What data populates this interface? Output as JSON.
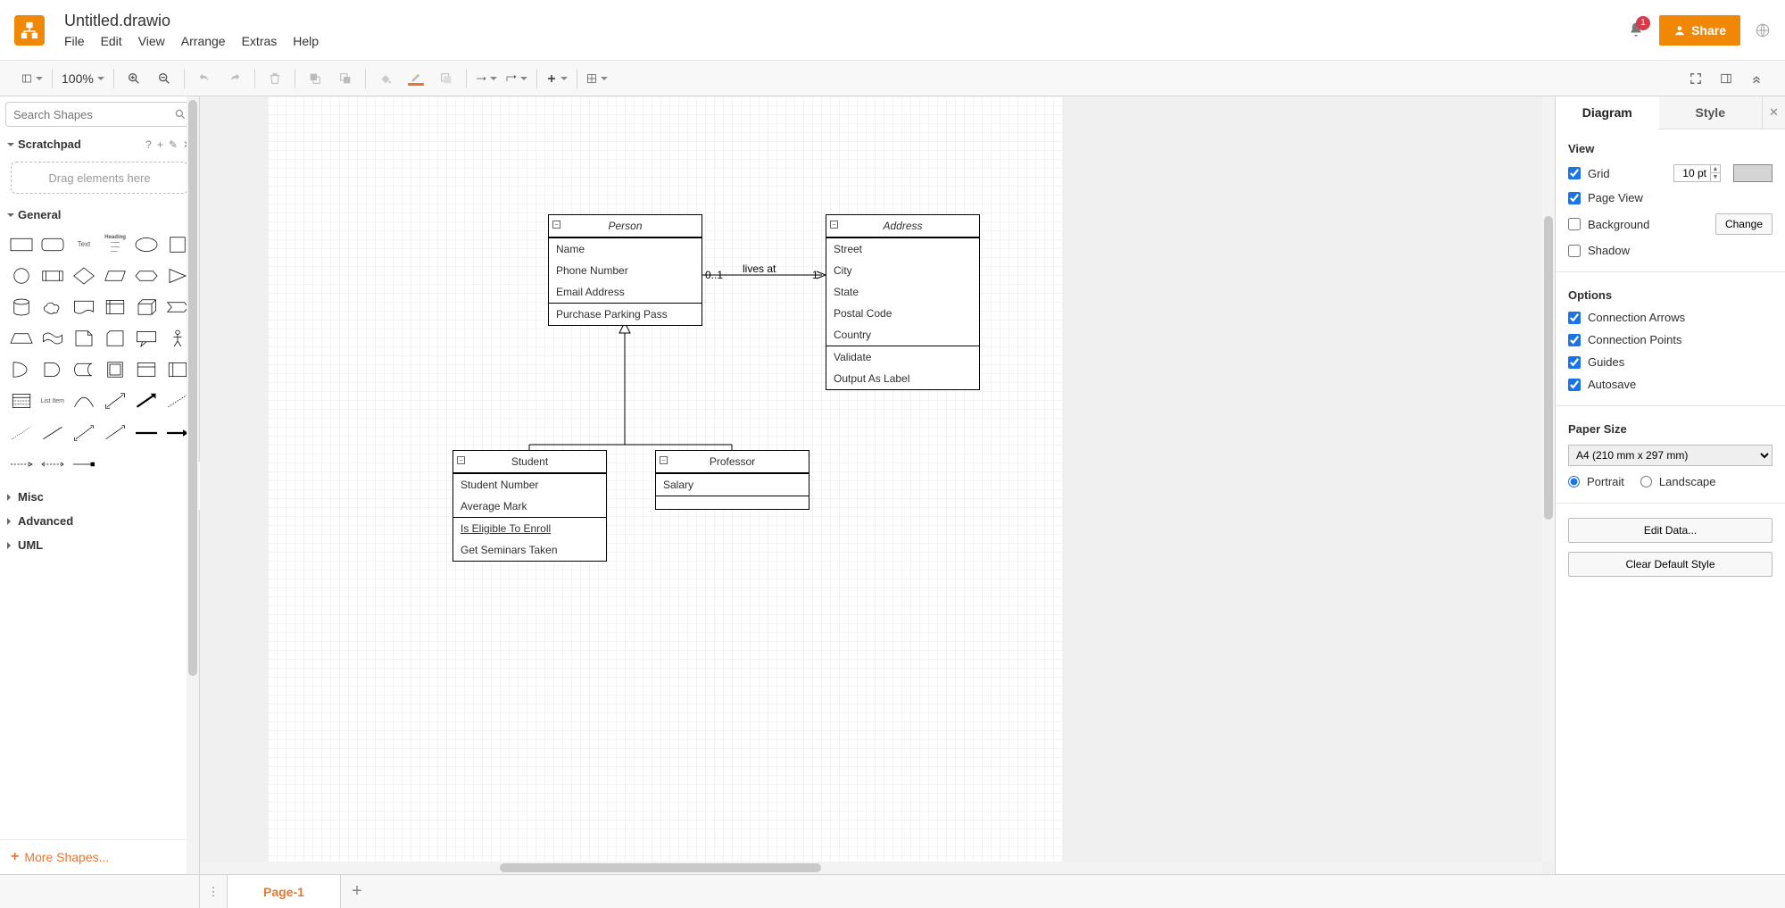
{
  "app": {
    "doc_title": "Untitled.drawio",
    "menus": [
      "File",
      "Edit",
      "View",
      "Arrange",
      "Extras",
      "Help"
    ],
    "notif_count": "1",
    "share": "Share"
  },
  "toolbar": {
    "zoom": "100%"
  },
  "sidebar": {
    "search_placeholder": "Search Shapes",
    "scratchpad": "Scratchpad",
    "scratch_drop": "Drag elements here",
    "general": "General",
    "misc": "Misc",
    "advanced": "Advanced",
    "uml": "UML",
    "more_shapes": "More Shapes...",
    "shape_text": "Text",
    "shape_heading": "Heading"
  },
  "canvas": {
    "person": {
      "title": "Person",
      "r0": "Name",
      "r1": "Phone Number",
      "r2": "Email Address",
      "m0": "Purchase Parking Pass"
    },
    "address": {
      "title": "Address",
      "r0": "Street",
      "r1": "City",
      "r2": "State",
      "r3": "Postal Code",
      "r4": "Country",
      "m0": "Validate",
      "m1": "Output As Label"
    },
    "student": {
      "title": "Student",
      "r0": "Student Number",
      "r1": "Average Mark",
      "m0": "Is Eligible To Enroll",
      "m1": "Get Seminars Taken"
    },
    "professor": {
      "title": "Professor",
      "r0": "Salary"
    },
    "edge": {
      "label": "lives at",
      "m_left": "0..1",
      "m_right": "1"
    }
  },
  "panel": {
    "tab_diagram": "Diagram",
    "tab_style": "Style",
    "view": "View",
    "grid": "Grid",
    "grid_value": "10 pt",
    "page_view": "Page View",
    "background": "Background",
    "change": "Change",
    "shadow": "Shadow",
    "options": "Options",
    "conn_arrows": "Connection Arrows",
    "conn_points": "Connection Points",
    "guides": "Guides",
    "autosave": "Autosave",
    "paper_size": "Paper Size",
    "paper_value": "A4 (210 mm x 297 mm)",
    "portrait": "Portrait",
    "landscape": "Landscape",
    "edit_data": "Edit Data...",
    "clear_style": "Clear Default Style"
  },
  "footer": {
    "page1": "Page-1"
  }
}
